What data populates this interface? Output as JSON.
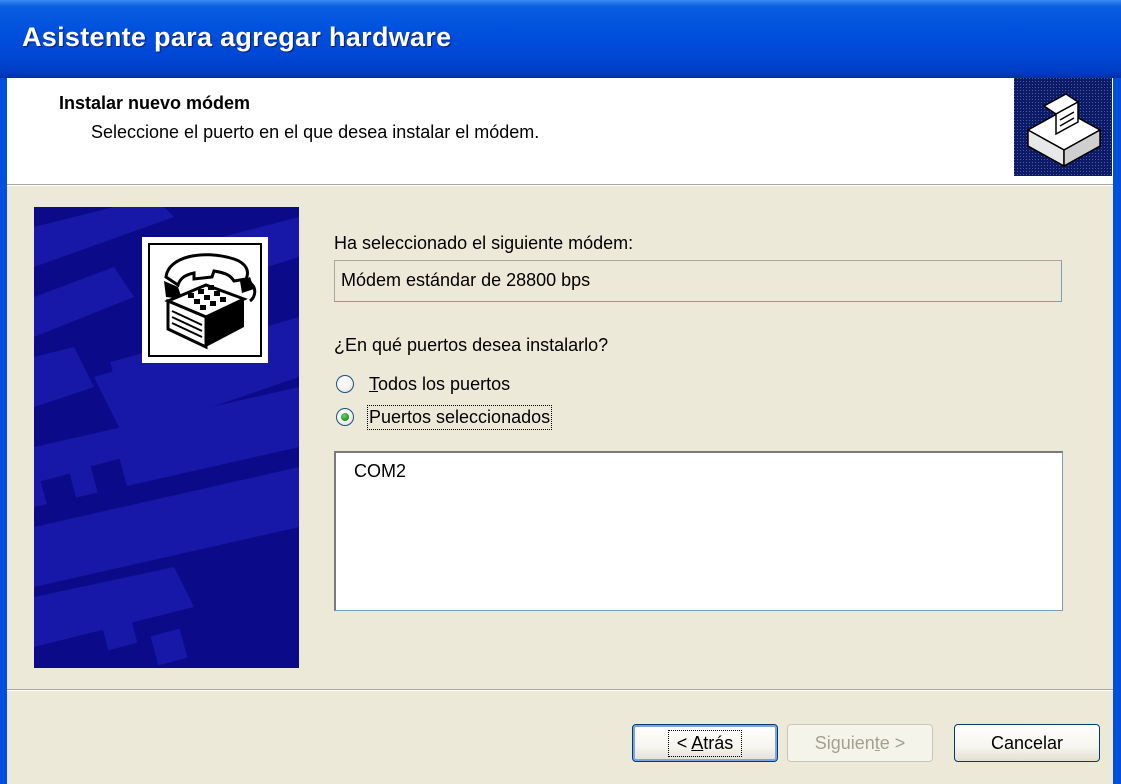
{
  "window": {
    "title": "Asistente para agregar hardware"
  },
  "header": {
    "title": "Instalar nuevo módem",
    "subtitle": "Seleccione el puerto en el que desea instalar el módem."
  },
  "main": {
    "selected_label": "Ha seleccionado el siguiente módem:",
    "modem_name": "Módem estándar de 28800 bps",
    "question": "¿En qué puertos desea instalarlo?",
    "radio_all": {
      "label_accel": "T",
      "label_rest": "odos los puertos",
      "checked": false
    },
    "radio_selected": {
      "label": "Puertos seleccionados",
      "checked": true
    },
    "ports": [
      "COM2"
    ]
  },
  "buttons": {
    "back": {
      "pre": "< ",
      "accel": "A",
      "post": "trás"
    },
    "next": {
      "pre": "Siguien",
      "accel": "t",
      "post": "e >"
    },
    "cancel": "Cancelar"
  },
  "colors": {
    "titlebar": "#0050de",
    "banner": "#0b0b8a",
    "dialog_bg": "#ece9d8"
  }
}
